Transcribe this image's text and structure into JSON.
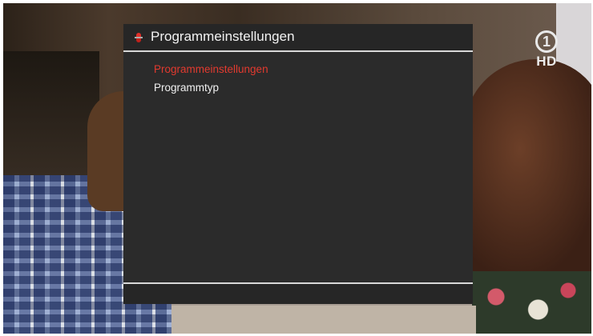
{
  "osd": {
    "title": "Programmeinstellungen",
    "menu_items": [
      {
        "label": "Programmeinstellungen",
        "selected": true
      },
      {
        "label": "Programmtyp",
        "selected": false
      }
    ],
    "accent_color": "#e23a2f",
    "header_icon": "up-down-arrow-icon"
  },
  "channel_logo": {
    "numeral": "1",
    "suffix": "HD"
  }
}
